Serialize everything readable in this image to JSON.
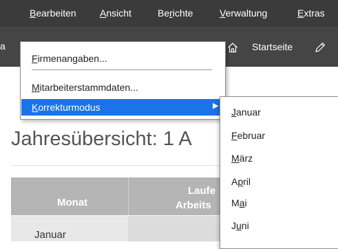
{
  "menubar": {
    "items": [
      {
        "pre": "",
        "u": "B",
        "post": "earbeiten"
      },
      {
        "pre": "",
        "u": "A",
        "post": "nsicht"
      },
      {
        "pre": "Be",
        "u": "r",
        "post": "ichte"
      },
      {
        "pre": "",
        "u": "V",
        "post": "erwaltung"
      },
      {
        "pre": "",
        "u": "E",
        "post": "xtras"
      }
    ]
  },
  "toolbar": {
    "left_text": "a",
    "start_label": "Startseite",
    "icons": [
      "home-icon",
      "edit-pencil-icon"
    ]
  },
  "dropdown": {
    "items": [
      {
        "pre": "",
        "u": "F",
        "post": "irmenangaben..."
      },
      {
        "pre": "",
        "u": "M",
        "post": "itarbeiterstammdaten..."
      },
      {
        "pre": "",
        "u": "K",
        "post": "orrekturmodus"
      }
    ],
    "submenu_arrow": "▶"
  },
  "submenu": {
    "items": [
      {
        "pre": "",
        "u": "J",
        "post": "anuar"
      },
      {
        "pre": "",
        "u": "F",
        "post": "ebruar"
      },
      {
        "pre": "",
        "u": "M",
        "post": "ärz"
      },
      {
        "pre": "A",
        "u": "p",
        "post": "ril"
      },
      {
        "pre": "M",
        "u": "a",
        "post": "i"
      },
      {
        "pre": "J",
        "u": "u",
        "post": "ni"
      }
    ]
  },
  "page": {
    "title": "Jahresübersicht: 1  A"
  },
  "table": {
    "headers": {
      "monat": "Monat",
      "lauf_line1": "Laufe",
      "lauf_line2": "Arbeits"
    },
    "rows": [
      {
        "month": "Januar"
      }
    ]
  },
  "colors": {
    "menubar_bg": "#3b3b3b",
    "toolbar_bg": "#454545",
    "highlight": "#1a73e8",
    "table_header_bg": "#b5b5b5"
  }
}
